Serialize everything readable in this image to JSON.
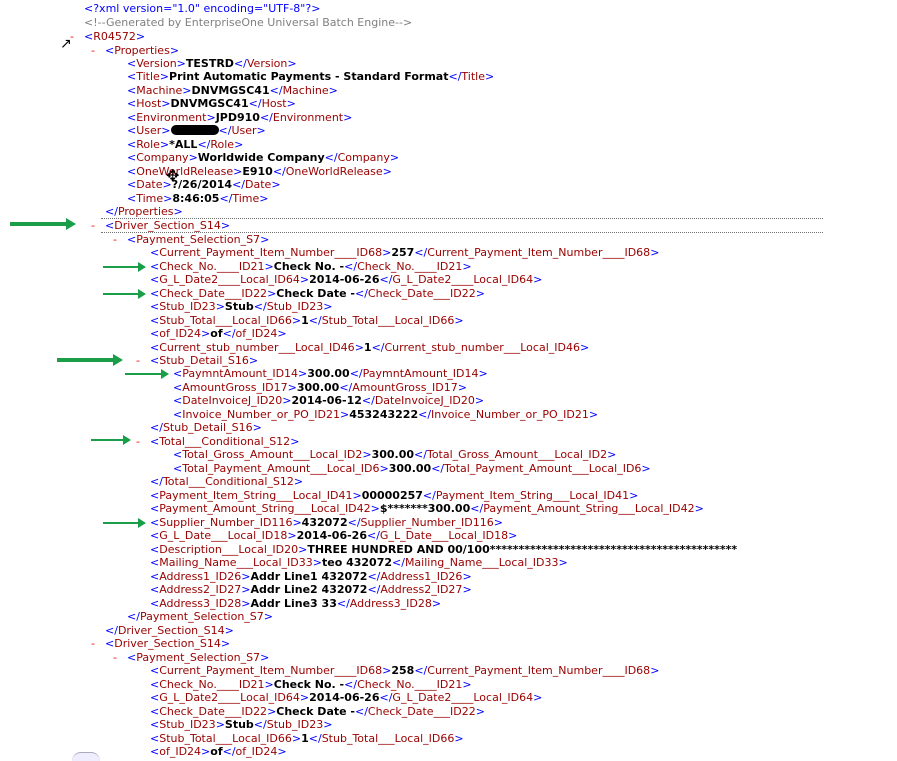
{
  "xml_decl": "<?xml version=\"1.0\" encoding=\"UTF-8\"?>",
  "comment": "<!--Generated by EnterpriseOne Universal Batch Engine-->",
  "root": "R04572",
  "properties": {
    "tag": "Properties",
    "version": "TESTRD",
    "title": "Print Automatic Payments - Standard Format",
    "machine": "DNVMGSC41",
    "host": "DNVMGSC41",
    "environment": "JPD910",
    "user": "",
    "role": "*ALL",
    "company": "Worldwide Company",
    "owrelease": "E910",
    "date": "?/26/2014",
    "time": "8:46:05"
  },
  "driver_tag": "Driver_Section_S14",
  "payment_tag": "Payment_Selection_S7",
  "stub_detail_tag": "Stub_Detail_S16",
  "total_cond_tag": "Total___Conditional_S12",
  "section1": {
    "cur_item_number": "257",
    "check_no": "Check No. -",
    "gl_date2": "2014-06-26",
    "check_date": "Check Date -",
    "stub": "Stub",
    "stub_total": "1",
    "of": "of",
    "current_stub_number": "1",
    "paymnt_amount": "300.00",
    "amount_gross": "300.00",
    "date_invoice": "2014-06-12",
    "invoice_number": "453243222",
    "total_gross_amount": "300.00",
    "total_payment_amount": "300.00",
    "payment_item_string": "00000257",
    "payment_amount_string": "$*******300.00",
    "supplier_number": "432072",
    "gl_date": "2014-06-26",
    "description": "THREE HUNDRED AND 00/100*******************************************",
    "mailing_name": "teo 432072",
    "address1": "Addr Line1 432072",
    "address2": "Addr Line2 432072",
    "address3": "Addr Line3 33"
  },
  "section2": {
    "cur_item_number": "258",
    "check_no": "Check No. -",
    "gl_date2": "2014-06-26",
    "check_date": "Check Date -",
    "stub": "Stub",
    "stub_total": "1",
    "of": "of"
  },
  "colors": {
    "bracket": "#0000ff",
    "element_name": "#990000",
    "text_value": "#000000",
    "toggle": "#ff0000",
    "comment": "#808080",
    "arrow": "#1a9e49"
  }
}
